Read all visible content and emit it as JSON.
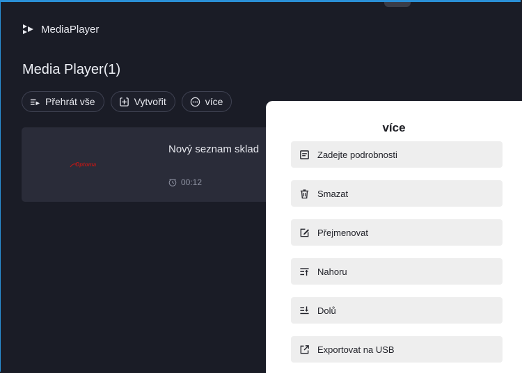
{
  "app": {
    "name": "MediaPlayer"
  },
  "page": {
    "title": "Media Player(1)"
  },
  "toolbar": {
    "play_all": "Přehrát vše",
    "create": "Vytvořit",
    "more": "více"
  },
  "playlist": {
    "brand": "Optoma",
    "title": "Nový seznam sklad",
    "duration": "00:12"
  },
  "more_menu": {
    "title": "více",
    "items": [
      {
        "label": "Zadejte podrobnosti",
        "icon": "details-icon"
      },
      {
        "label": "Smazat",
        "icon": "trash-icon"
      },
      {
        "label": "Přejmenovat",
        "icon": "edit-icon"
      },
      {
        "label": "Nahoru",
        "icon": "move-up-icon"
      },
      {
        "label": "Dolů",
        "icon": "move-down-icon"
      },
      {
        "label": "Exportovat na USB",
        "icon": "export-icon"
      }
    ]
  },
  "colors": {
    "background": "#1a1c26",
    "card": "#2a2c39",
    "accent_border": "#2a8fd6",
    "brand_red": "#b01a1a"
  }
}
